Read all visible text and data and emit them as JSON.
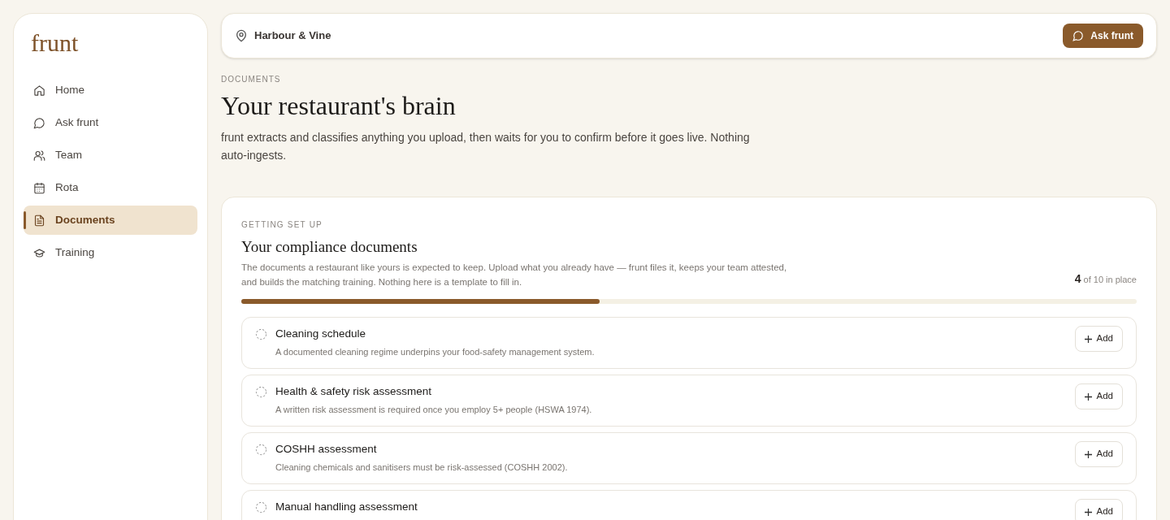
{
  "sidebar": {
    "logo": "frunt",
    "items": [
      {
        "label": "Home",
        "selected": false
      },
      {
        "label": "Ask frunt",
        "selected": false
      },
      {
        "label": "Team",
        "selected": false
      },
      {
        "label": "Rota",
        "selected": false
      },
      {
        "label": "Documents",
        "selected": true
      },
      {
        "label": "Training",
        "selected": false
      }
    ]
  },
  "topbar": {
    "location": "Harbour & Vine",
    "button": "Ask frunt"
  },
  "header": {
    "eyebrow": "DOCUMENTS",
    "title": "Your restaurant's brain",
    "description": "frunt extracts and classifies anything you upload, then waits for you to confirm before it goes live. Nothing auto-ingests."
  },
  "card": {
    "eyebrow": "GETTING SET UP",
    "title": "Your compliance documents",
    "description": "The documents a restaurant like yours is expected to keep. Upload what you already have — frunt files it, keeps your team attested, and builds the matching training. Nothing here is a template to fill in.",
    "count": "4",
    "count_suffix": "of 10 in place",
    "level": 0.4,
    "documents": [
      {
        "title": "Cleaning schedule",
        "description": "A documented cleaning regime underpins your food-safety management system.",
        "done": false,
        "button": "Add"
      },
      {
        "title": "Health & safety risk assessment",
        "description": "A written risk assessment is required once you employ 5+ people (HSWA 1974).",
        "done": false,
        "button": "Add"
      },
      {
        "title": "COSHH assessment",
        "description": "Cleaning chemicals and sanitisers must be risk-assessed (COSHH 2002).",
        "done": false,
        "button": "Add"
      },
      {
        "title": "Manual handling assessment",
        "done": false,
        "button": "Add"
      }
    ]
  }
}
